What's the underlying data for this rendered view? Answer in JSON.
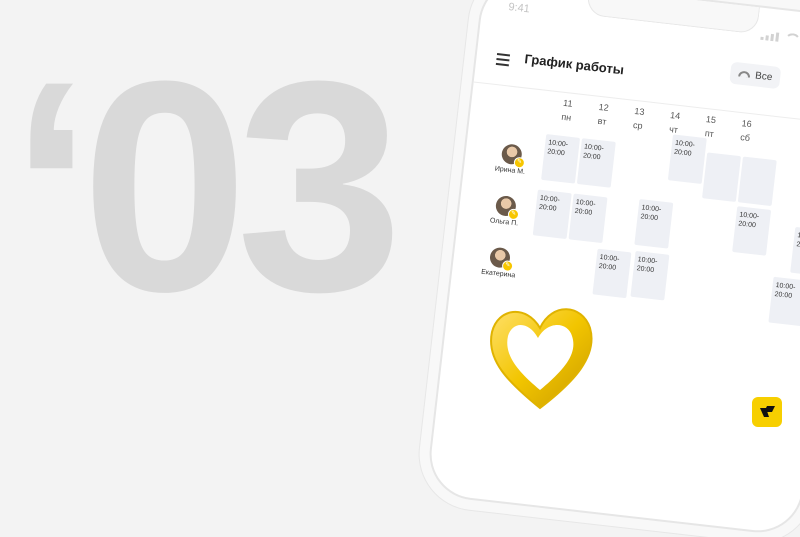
{
  "decor": {
    "big_number": "‘03"
  },
  "phone": {
    "status_time": "9:41",
    "header": {
      "title": "График работы",
      "filter_label": "Все"
    },
    "days": [
      {
        "num": "11",
        "dow": "пн"
      },
      {
        "num": "12",
        "dow": "вт"
      },
      {
        "num": "13",
        "dow": "ср"
      },
      {
        "num": "14",
        "dow": "чт"
      },
      {
        "num": "15",
        "dow": "пт"
      },
      {
        "num": "16",
        "dow": "сб"
      }
    ],
    "employees": [
      {
        "name": "Ирина М."
      },
      {
        "name": "Ольга П."
      },
      {
        "name": "Екатерина"
      }
    ],
    "shift_time": "10:00–\n20:00",
    "shifts": {
      "s1": "10:00-\n20:00",
      "s2": "10:00-\n20:00",
      "s3": "10:00-\n20:00",
      "s4": "10:00-\n20:00",
      "s5": "10:00-\n20:00",
      "s6": "10:00-\n20:00",
      "s7": "10:00-\n20:00",
      "s8": "10:00-\n20:00",
      "s9": "10:00-\n20:00",
      "s10": "10:00-\n20:00",
      "s11": "10:00-\n20:00"
    }
  },
  "colors": {
    "accent": "#f7c600",
    "background": "#f3f3f3",
    "big_number": "#d9d9d9"
  },
  "icons": {
    "menu": "hamburger-icon",
    "filter": "gauge-icon",
    "logo": "brand-logo"
  }
}
